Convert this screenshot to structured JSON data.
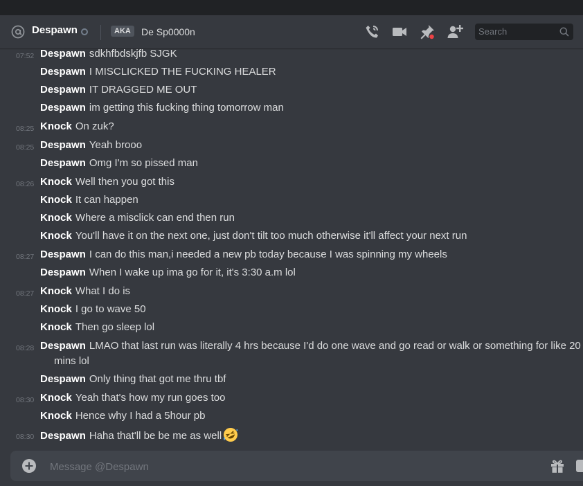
{
  "header": {
    "dm_name": "Despawn",
    "aka_label": "AKA",
    "aka_name": "De Sp0000n",
    "search_placeholder": "Search"
  },
  "messages": [
    {
      "time": "07:52",
      "author": "Despawn",
      "text": "sdkhfbdskjfb SJGK"
    },
    {
      "time": "",
      "author": "Despawn",
      "text": "I MISCLICKED THE FUCKING HEALER"
    },
    {
      "time": "",
      "author": "Despawn",
      "text": "IT DRAGGED ME OUT"
    },
    {
      "time": "",
      "author": "Despawn",
      "text": "im getting this fucking thing tomorrow man"
    },
    {
      "time": "08:25",
      "author": "Knock",
      "text": "On zuk?"
    },
    {
      "time": "08:25",
      "author": "Despawn",
      "text": "Yeah brooo"
    },
    {
      "time": "",
      "author": "Despawn",
      "text": "Omg I'm so pissed man"
    },
    {
      "time": "08:26",
      "author": "Knock",
      "text": "Well then you got this"
    },
    {
      "time": "",
      "author": "Knock",
      "text": "It can happen"
    },
    {
      "time": "",
      "author": "Knock",
      "text": "Where a misclick can end then run"
    },
    {
      "time": "",
      "author": "Knock",
      "text": "You'll have it on the next one, just don't tilt too much otherwise it'll affect your next run"
    },
    {
      "time": "08:27",
      "author": "Despawn",
      "text": "I can do this man,i needed a new pb today because I was spinning my wheels"
    },
    {
      "time": "",
      "author": "Despawn",
      "text": "When I wake up ima go for it, it's 3:30 a.m lol"
    },
    {
      "time": "08:27",
      "author": "Knock",
      "text": "What I do is"
    },
    {
      "time": "",
      "author": "Knock",
      "text": "I go to wave 50"
    },
    {
      "time": "",
      "author": "Knock",
      "text": "Then go sleep lol"
    },
    {
      "time": "08:28",
      "author": "Despawn",
      "text": "LMAO that last run was literally 4 hrs because I'd do one wave and go read or walk or something for like 20",
      "text2": "mins lol"
    },
    {
      "time": "",
      "author": "Despawn",
      "text": "Only thing that got me thru tbf"
    },
    {
      "time": "08:30",
      "author": "Knock",
      "text": "Yeah that's how my run goes too"
    },
    {
      "time": "",
      "author": "Knock",
      "text": "Hence why I had a 5hour pb"
    },
    {
      "time": "08:30",
      "author": "Despawn",
      "text": "Haha that'll be be me as well",
      "emoji": "rofl-emoji"
    }
  ],
  "composer": {
    "placeholder": "Message @Despawn"
  },
  "colors": {
    "background": "#36393f",
    "composer": "#40444b",
    "author": "#ffffff",
    "text": "#dcddde",
    "timestamp": "#72767d",
    "notification": "#ed4245"
  }
}
